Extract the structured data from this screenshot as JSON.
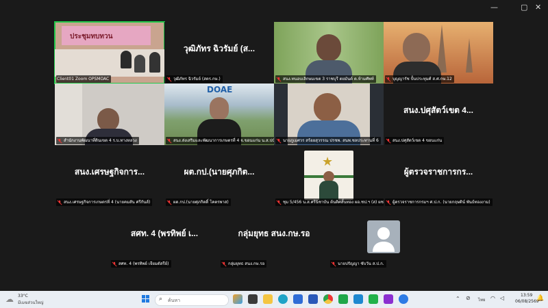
{
  "window_controls": {
    "minimize": "—",
    "maximize": "▢",
    "close": "✕"
  },
  "tiles": [
    {
      "label": "Client01 Zoom OPSMOAC",
      "banner": "ประชุมทบทวน"
    },
    {
      "name": "วุฒิภัทร ฉิวรัมย์ (ส...",
      "label": "วุฒิภัทร ฉิวรัมย์ (สตร.กษ.)"
    },
    {
      "label": "สนง.ทนอบเลิกษมเขต 3 ราชบุรี ตยมันต์ ต.ห้ามศัพท์"
    },
    {
      "label": "บุญญารัช ปั้นประทุมศ์ ส.ศ.กษ.12"
    },
    {
      "label": "สำนักงานพัฒนาที่ดินเขต 4 ร.บ.ทางหลวง"
    },
    {
      "label": "สนง.ส่งเสริมและพัฒนาการเกษตรที่ 4 จ.ขอนแก่น น.ส.ปนันท์...",
      "banner": "DOAE"
    },
    {
      "label": "นายภูเมศวร สร้อยสุวรรณ ปรชพ. สนพ.ชลประทานที่ 6"
    },
    {
      "name": "สนง.ปศุสัตว์เขต 4...",
      "label": "สนง.ปศุสัตว์เขต 4 ขอนแก่น"
    },
    {
      "name": "สนง.เศรษฐกิจการ...",
      "label": "สนง.เศรษฐกิจการเกษตรที่ 4 (นายคมสัน ศรีกันส์)"
    },
    {
      "name": "ผต.กป.(นายศุภกิต...",
      "label": "ผต.กป.(นายศุภกิตติ์ โคตรพาส)"
    },
    {
      "label": "ชุม 5/456 น.ส.ศรีนิชาบัน ต้นติศสั้นทอง ผอ.ชป.ฯ (ส) ผช.(ฯ)"
    },
    {
      "name": "ผู้ตรวจราชการกร...",
      "label": "ผู้ตรวจราชการกรมฯ ศ.ป.ก. (นายกฤษติน์ พันธ์ทองงาม)"
    },
    {
      "name": "สศท. 4 (พรทิพย์ เ...",
      "label": "สศท. 4 (พรทิพย์ เจียมดัสรีย์)"
    },
    {
      "name": "กลุ่มยุทธ สนง.กษ.รอ",
      "label": "กลุ่มยุทธ สนง.กษ.รอ"
    },
    {
      "label": "นายปรัญญา ซับวัน ส.ป.ก."
    }
  ],
  "taskbar": {
    "weather_temp": "33°C",
    "weather_desc": "มีเมฆส่วนใหญ่",
    "search_placeholder": "ค้นหา",
    "language": "ไทย",
    "time": "13:59",
    "date": "06/08/2569"
  }
}
